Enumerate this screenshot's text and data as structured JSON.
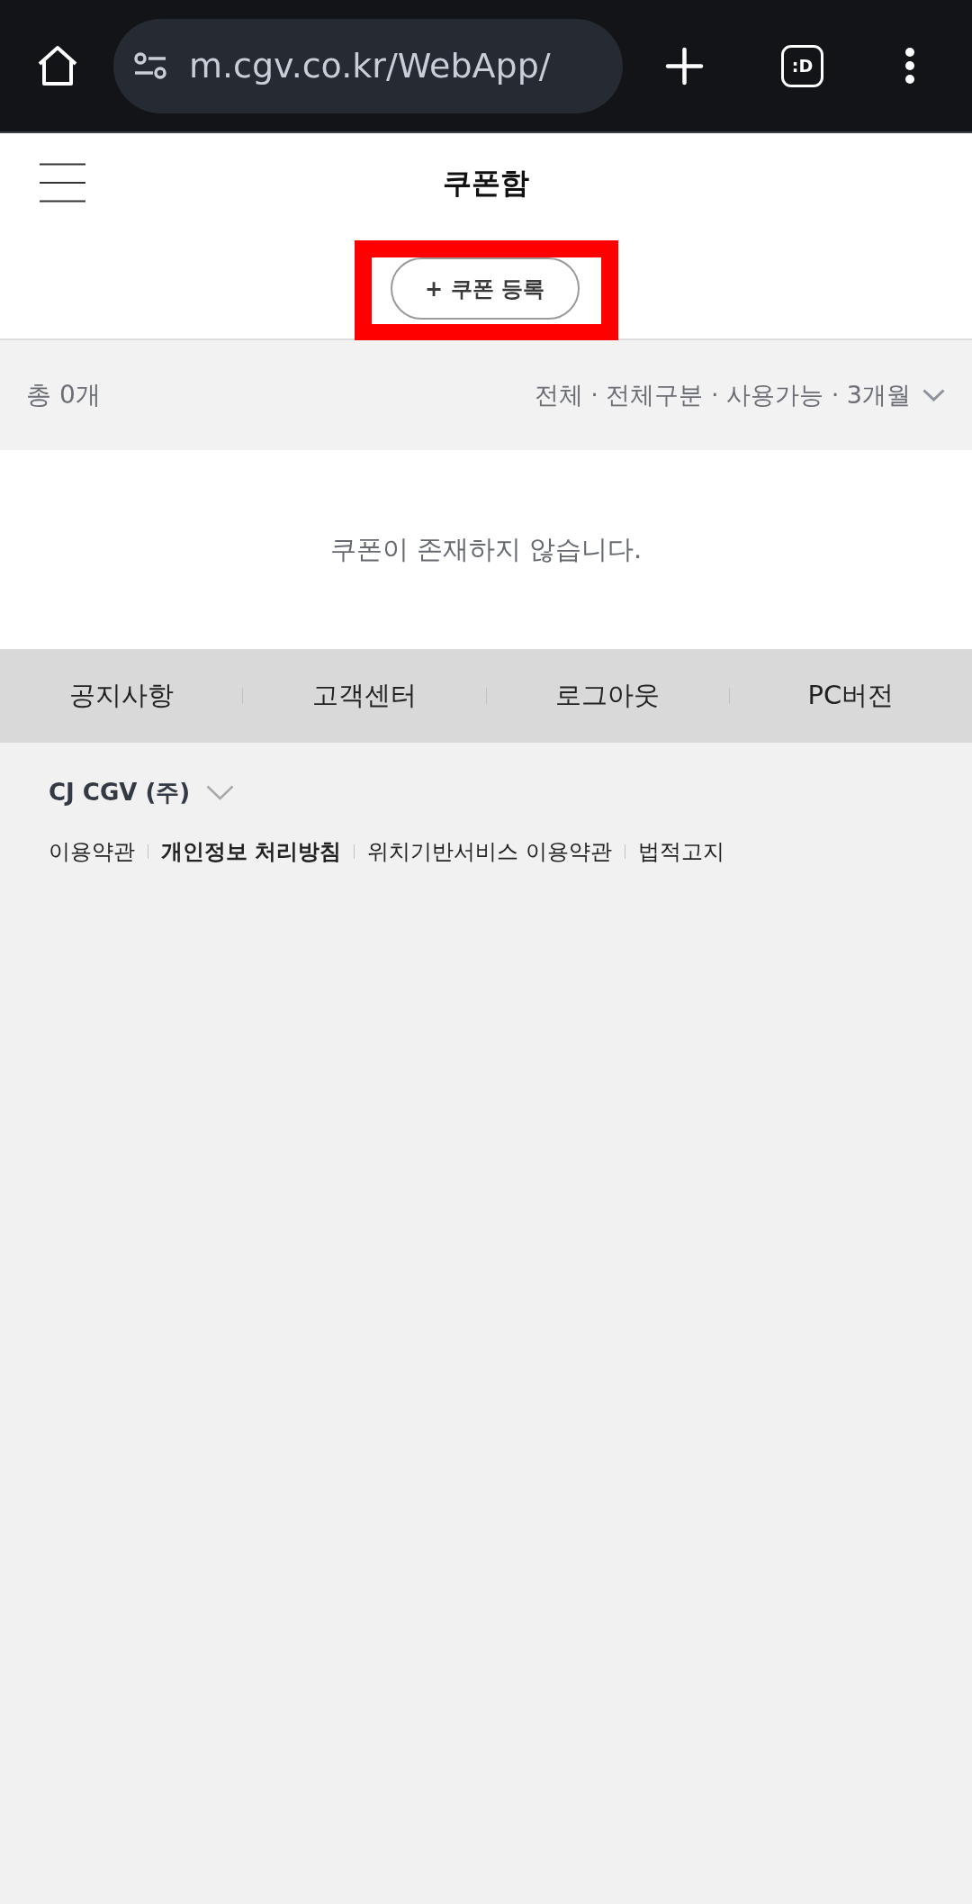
{
  "browser": {
    "url": "m.cgv.co.kr/WebApp/",
    "tab_count": ":D"
  },
  "header": {
    "title": "쿠폰함"
  },
  "coupon_button": {
    "label": "+ 쿠폰 등록",
    "highlighted": true
  },
  "filter_bar": {
    "count": "총 0개",
    "summary": "전체 · 전체구분 · 사용가능 · 3개월"
  },
  "empty_message": "쿠폰이 존재하지 않습니다.",
  "footer_nav": [
    "공지사항",
    "고객센터",
    "로그아웃",
    "PC버전"
  ],
  "company": {
    "name": "CJ CGV (주)",
    "expanded": false
  },
  "legal_links": [
    {
      "label": "이용약관",
      "emphasized": false
    },
    {
      "label": "개인정보 처리방침",
      "emphasized": true
    },
    {
      "label": "위치기반서비스 이용약관",
      "emphasized": false
    },
    {
      "label": "법적고지",
      "emphasized": false
    }
  ]
}
